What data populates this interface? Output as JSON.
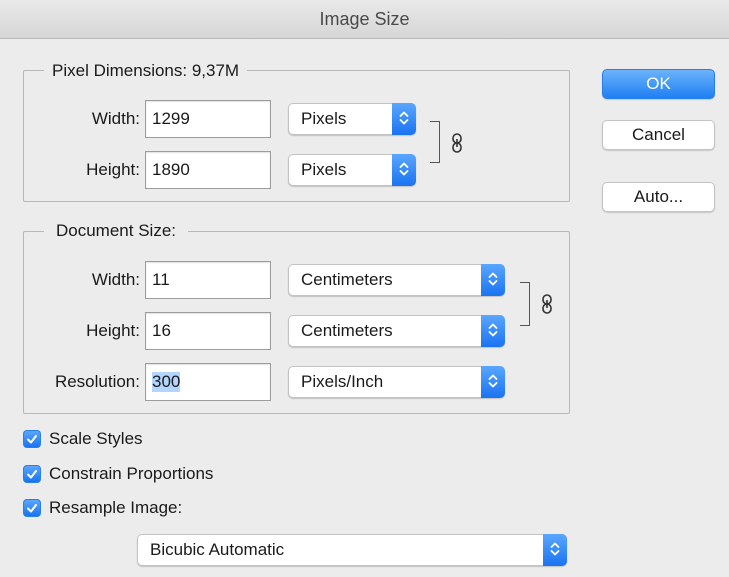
{
  "window": {
    "title": "Image Size"
  },
  "pixel_dimensions": {
    "legend": "Pixel Dimensions:",
    "size": "9,37M",
    "width": {
      "label": "Width:",
      "value": "1299",
      "unit": "Pixels"
    },
    "height": {
      "label": "Height:",
      "value": "1890",
      "unit": "Pixels"
    }
  },
  "document_size": {
    "legend": "Document Size:",
    "width": {
      "label": "Width:",
      "value": "11",
      "unit": "Centimeters"
    },
    "height": {
      "label": "Height:",
      "value": "16",
      "unit": "Centimeters"
    },
    "resolution": {
      "label": "Resolution:",
      "value": "300",
      "unit": "Pixels/Inch"
    }
  },
  "options": {
    "scale_styles": {
      "label": "Scale Styles",
      "checked": true
    },
    "constrain_proportions": {
      "label": "Constrain Proportions",
      "checked": true
    },
    "resample_image": {
      "label": "Resample Image:",
      "checked": true
    }
  },
  "resample_method": "Bicubic Automatic",
  "buttons": {
    "ok": "OK",
    "cancel": "Cancel",
    "auto": "Auto..."
  },
  "colors": {
    "accent": "#1f7ff3",
    "selection": "#b4d5fe",
    "background": "#ececec"
  },
  "icons": {
    "link": "chain-link-icon",
    "stepper": "chevron-updown-icon",
    "check": "checkmark-icon"
  }
}
